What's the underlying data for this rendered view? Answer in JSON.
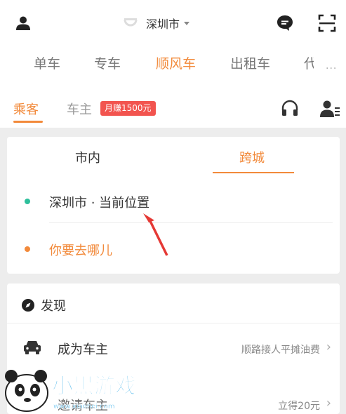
{
  "header": {
    "city": "深圳市",
    "service_tabs": [
      "单车",
      "专车",
      "顺风车",
      "出租车",
      "代"
    ],
    "active_service": "顺风车",
    "more": "···"
  },
  "roles": {
    "passenger": "乘客",
    "driver": "车主",
    "badge": "月赚1500元"
  },
  "trip": {
    "mode_tabs": [
      "市内",
      "跨城"
    ],
    "active_mode": "跨城",
    "from": "深圳市 · 当前位置",
    "to": "你要去哪儿"
  },
  "discover": {
    "title": "发现",
    "items": [
      {
        "title": "成为车主",
        "subtitle": "顺路接人平摊油费"
      },
      {
        "title": "邀请车主",
        "subtitle": "立得20元"
      }
    ]
  },
  "watermark": {
    "brand": "小黑游戏",
    "url": "www.xiaohei.com"
  },
  "colors": {
    "accent": "#f28a3b",
    "badge": "#f2544f",
    "origin_dot": "#2dbf9b",
    "arrow": "#e53935"
  }
}
